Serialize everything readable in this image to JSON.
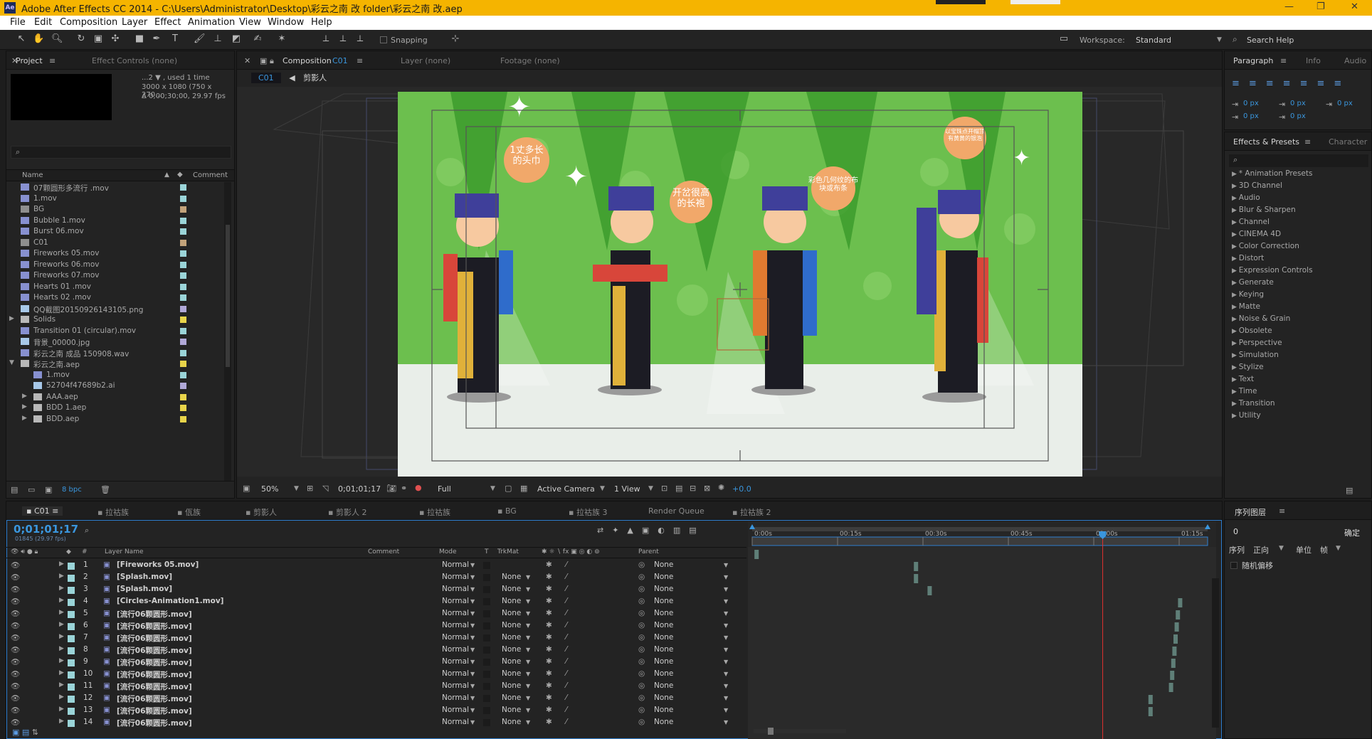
{
  "app": {
    "title": "Adobe After Effects CC 2014 - C:\\Users\\Administrator\\Desktop\\彩云之南 改 folder\\彩云之南 改.aep",
    "icon": "Ae"
  },
  "menu": [
    "File",
    "Edit",
    "Composition",
    "Layer",
    "Effect",
    "Animation",
    "View",
    "Window",
    "Help"
  ],
  "toolbar": {
    "snapping": "Snapping",
    "workspace_label": "Workspace:",
    "workspace_value": "Standard",
    "search_help": "Search Help"
  },
  "project": {
    "tab_project": "Project",
    "tab_effect_controls": "Effect Controls (none)",
    "info_line1": "...2 ▼ , used 1 time",
    "info_line2": "3000 x 1080  (750 x 270...",
    "info_line3": "Δ 0;00;30;00, 29.97 fps",
    "col_name": "Name",
    "col_comment": "Comment",
    "bpc": "8 bpc",
    "items": [
      {
        "name": "07颗圆形多流行 .mov",
        "color": "#9ad4d8",
        "indent": 0,
        "type": "file"
      },
      {
        "name": "1.mov",
        "color": "#9ad4d8",
        "indent": 0,
        "type": "file"
      },
      {
        "name": "BG",
        "color": "#c2a27a",
        "indent": 0,
        "type": "comp"
      },
      {
        "name": "Bubble 1.mov",
        "color": "#9ad4d8",
        "indent": 0,
        "type": "file"
      },
      {
        "name": "Burst 06.mov",
        "color": "#9ad4d8",
        "indent": 0,
        "type": "file"
      },
      {
        "name": "C01",
        "color": "#c2a27a",
        "indent": 0,
        "type": "comp"
      },
      {
        "name": "Fireworks 05.mov",
        "color": "#9ad4d8",
        "indent": 0,
        "type": "file"
      },
      {
        "name": "Fireworks 06.mov",
        "color": "#9ad4d8",
        "indent": 0,
        "type": "file"
      },
      {
        "name": "Fireworks 07.mov",
        "color": "#9ad4d8",
        "indent": 0,
        "type": "file"
      },
      {
        "name": "Hearts 01 .mov",
        "color": "#9ad4d8",
        "indent": 0,
        "type": "file"
      },
      {
        "name": "Hearts 02 .mov",
        "color": "#9ad4d8",
        "indent": 0,
        "type": "file"
      },
      {
        "name": "QQ截图20150926143105.png",
        "color": "#b0a8d8",
        "indent": 0,
        "type": "image"
      },
      {
        "name": "Solids",
        "color": "#e8d44a",
        "indent": 0,
        "type": "folder",
        "arrow": "▶"
      },
      {
        "name": "Transition 01 (circular).mov",
        "color": "#9ad4d8",
        "indent": 0,
        "type": "file"
      },
      {
        "name": "背景_00000.jpg",
        "color": "#b0a8d8",
        "indent": 0,
        "type": "image"
      },
      {
        "name": "彩云之南  成品 150908.wav",
        "color": "#9ad4d8",
        "indent": 0,
        "type": "file"
      },
      {
        "name": "彩云之南.aep",
        "color": "#e8d44a",
        "indent": 0,
        "type": "folder",
        "arrow": "▼"
      },
      {
        "name": "1.mov",
        "color": "#9ad4d8",
        "indent": 1,
        "type": "file"
      },
      {
        "name": "52704f47689b2.ai",
        "color": "#b0a8d8",
        "indent": 1,
        "type": "image"
      },
      {
        "name": "AAA.aep",
        "color": "#e8d44a",
        "indent": 1,
        "type": "folder",
        "arrow": "▶"
      },
      {
        "name": "BDD 1.aep",
        "color": "#e8d44a",
        "indent": 1,
        "type": "folder",
        "arrow": "▶"
      },
      {
        "name": "BDD.aep",
        "color": "#e8d44a",
        "indent": 1,
        "type": "folder",
        "arrow": "▶"
      }
    ]
  },
  "composition": {
    "tab": "Composition",
    "comp_name": "C01",
    "tab_layer": "Layer (none)",
    "tab_footage": "Footage (none)",
    "crumb_active": "C01",
    "crumb_next": "剪影人",
    "zoom": "50%",
    "timecode": "0;01;01;17",
    "resolution": "Full",
    "camera": "Active Camera",
    "view": "1 View",
    "exposure": "+0.0",
    "bubbles": [
      "1丈多长\n的头巾",
      "开岔很高\n的长袍",
      "彩色几何纹的布\n块或布条",
      "以宝珠点开帽顶\n有黄黄的银泡"
    ]
  },
  "right": {
    "tab_paragraph": "Paragraph",
    "tab_info": "Info",
    "tab_audio": "Audio",
    "px_values": [
      "0 px",
      "0 px",
      "0 px",
      "0 px",
      "0 px"
    ],
    "tab_effects": "Effects & Presets",
    "tab_character": "Character",
    "effects": [
      "* Animation Presets",
      "3D Channel",
      "Audio",
      "Blur & Sharpen",
      "Channel",
      "CINEMA 4D",
      "Color Correction",
      "Distort",
      "Expression Controls",
      "Generate",
      "Keying",
      "Matte",
      "Noise & Grain",
      "Obsolete",
      "Perspective",
      "Simulation",
      "Stylize",
      "Text",
      "Time",
      "Transition",
      "Utility"
    ],
    "seq_title": "序列图层",
    "seq_value": "0",
    "seq_ok": "确定",
    "seq_label": "序列",
    "seq_dir": "正向",
    "seq_unit_label": "单位",
    "seq_unit": "帧",
    "seq_random": "随机偏移"
  },
  "timeline": {
    "tabs": [
      "C01",
      "拉祜族",
      "佤族",
      "剪影人",
      "剪影人 2",
      "拉祜族",
      "BG",
      "拉祜族 3",
      "Render Queue",
      "拉祜族 2"
    ],
    "timecode": "0;01;01;17",
    "fps_line": "01845 (29.97 fps)",
    "col_layer_name": "Layer Name",
    "col_comment": "Comment",
    "col_mode": "Mode",
    "col_t": "T",
    "col_trkmat": "TrkMat",
    "col_parent": "Parent",
    "col_num": "#",
    "ruler": [
      "0:00s",
      "00:15s",
      "00:30s",
      "00:45s",
      "01:00s",
      "01:15s"
    ],
    "playhead": 61.57,
    "duration": 80,
    "layers": [
      {
        "num": "1",
        "name": "[Fireworks 05.mov]",
        "mode": "Normal",
        "trkmat": "",
        "parent": "None",
        "color": "#9ad4d8",
        "bar": 0.4
      },
      {
        "num": "2",
        "name": "[Splash.mov]",
        "mode": "Normal",
        "trkmat": "None",
        "parent": "None",
        "color": "#9ad4d8",
        "bar": 28.4
      },
      {
        "num": "3",
        "name": "[Splash.mov]",
        "mode": "Normal",
        "trkmat": "None",
        "parent": "None",
        "color": "#9ad4d8",
        "bar": 28.4
      },
      {
        "num": "4",
        "name": "[Circles-Animation1.mov]",
        "mode": "Normal",
        "trkmat": "None",
        "parent": "None",
        "color": "#9ad4d8",
        "bar": 30.8
      },
      {
        "num": "5",
        "name": "[流行06颗圆形.mov]",
        "mode": "Normal",
        "trkmat": "None",
        "parent": "None",
        "color": "#9ad4d8",
        "bar": 74.8
      },
      {
        "num": "6",
        "name": "[流行06颗圆形.mov]",
        "mode": "Normal",
        "trkmat": "None",
        "parent": "None",
        "color": "#9ad4d8",
        "bar": 74.4
      },
      {
        "num": "7",
        "name": "[流行06颗圆形.mov]",
        "mode": "Normal",
        "trkmat": "None",
        "parent": "None",
        "color": "#9ad4d8",
        "bar": 74.2
      },
      {
        "num": "8",
        "name": "[流行06颗圆形.mov]",
        "mode": "Normal",
        "trkmat": "None",
        "parent": "None",
        "color": "#9ad4d8",
        "bar": 74.0
      },
      {
        "num": "9",
        "name": "[流行06颗圆形.mov]",
        "mode": "Normal",
        "trkmat": "None",
        "parent": "None",
        "color": "#9ad4d8",
        "bar": 73.8
      },
      {
        "num": "10",
        "name": "[流行06颗圆形.mov]",
        "mode": "Normal",
        "trkmat": "None",
        "parent": "None",
        "color": "#9ad4d8",
        "bar": 73.6
      },
      {
        "num": "11",
        "name": "[流行06颗圆形.mov]",
        "mode": "Normal",
        "trkmat": "None",
        "parent": "None",
        "color": "#9ad4d8",
        "bar": 73.4
      },
      {
        "num": "12",
        "name": "[流行06颗圆形.mov]",
        "mode": "Normal",
        "trkmat": "None",
        "parent": "None",
        "color": "#9ad4d8",
        "bar": 73.2
      },
      {
        "num": "13",
        "name": "[流行06颗圆形.mov]",
        "mode": "Normal",
        "trkmat": "None",
        "parent": "None",
        "color": "#9ad4d8",
        "bar": 69.6
      },
      {
        "num": "14",
        "name": "[流行06颗圆形.mov]",
        "mode": "Normal",
        "trkmat": "None",
        "parent": "None",
        "color": "#9ad4d8",
        "bar": 69.6
      }
    ]
  }
}
